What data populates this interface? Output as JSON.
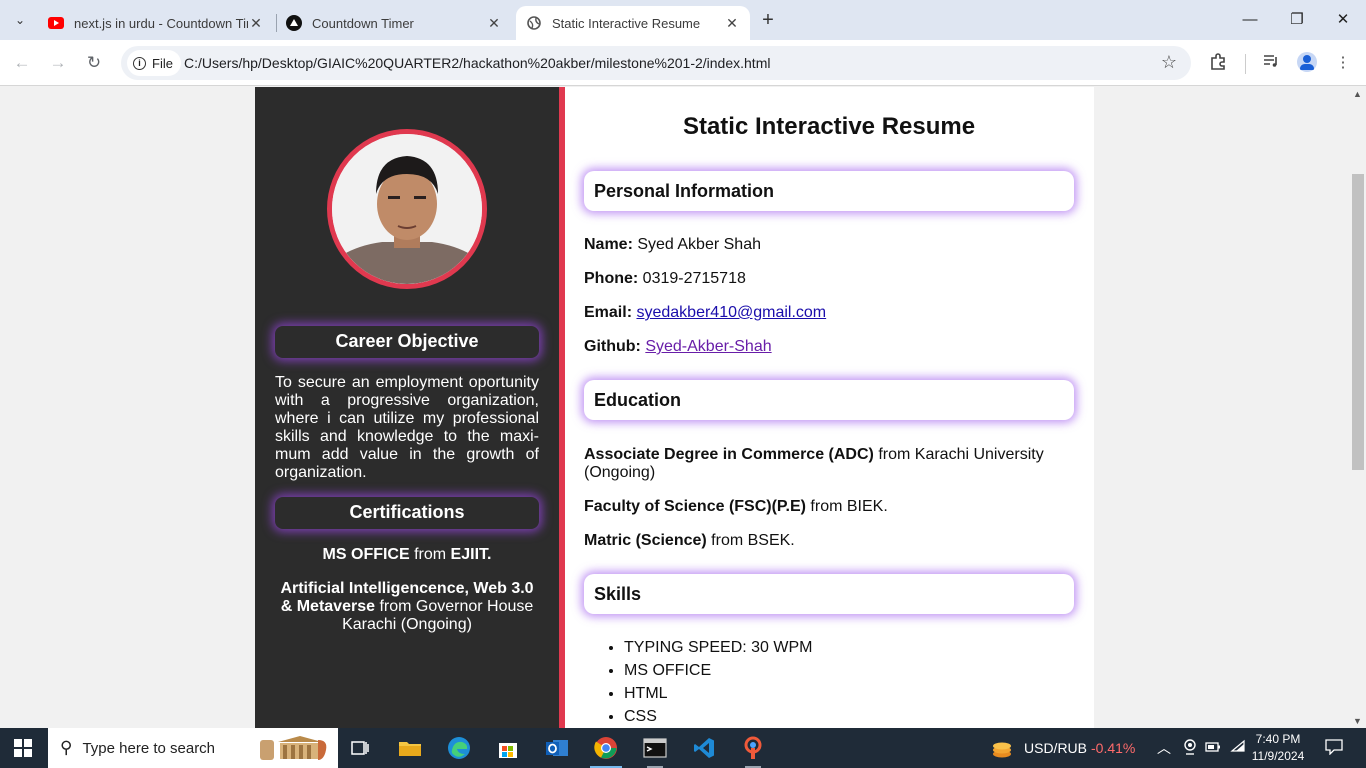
{
  "browser": {
    "tabs": [
      {
        "title": "next.js in urdu - Countdown Tin",
        "favicon": "youtube-icon",
        "active": false
      },
      {
        "title": "Countdown Timer",
        "favicon": "vercel-icon",
        "active": false
      },
      {
        "title": "Static Interactive Resume",
        "favicon": "globe-icon",
        "active": true
      }
    ],
    "address": {
      "scheme_label": "File",
      "url": "C:/Users/hp/Desktop/GIAIC%20QUARTER2/hackathon%20akber/milestone%201-2/index.html"
    }
  },
  "resume": {
    "title": "Static Interactive Resume",
    "left": {
      "career_heading": "Career Objective",
      "career_text": "To secure an employment oportunity with a progressive organization, where i can utilize my professional skills and knowledge to the maxi-mum add value in the growth of organization.",
      "cert_heading": "Certifications",
      "certifications": [
        {
          "bold": "MS OFFICE",
          "middle": " from ",
          "bold2": "EJIIT.",
          "rest": ""
        },
        {
          "bold": "Artificial Intelligencence, Web 3.0 & Metaverse",
          "middle": " from Governor House Karachi (Ongoing)",
          "bold2": "",
          "rest": ""
        }
      ]
    },
    "personal": {
      "heading": "Personal Information",
      "name_label": "Name:",
      "name": " Syed Akber Shah",
      "phone_label": "Phone:",
      "phone": " 0319-2715718",
      "email_label": "Email:",
      "email": "syedakber410@gmail.com",
      "github_label": "Github:",
      "github": "Syed-Akber-Shah"
    },
    "education": {
      "heading": "Education",
      "items": [
        {
          "degree": "Associate Degree in Commerce (ADC)",
          "rest": " from Karachi University (Ongoing)"
        },
        {
          "degree": "Faculty of Science (FSC)(P.E)",
          "rest": " from BIEK."
        },
        {
          "degree": "Matric (Science)",
          "rest": " from BSEK."
        }
      ]
    },
    "skills": {
      "heading": "Skills",
      "items": [
        "TYPING SPEED: 30 WPM",
        "MS OFFICE",
        "HTML",
        "CSS"
      ]
    }
  },
  "taskbar": {
    "search_placeholder": "Type here to search",
    "ticker_label": "USD/RUB",
    "ticker_value": "-0.41%",
    "ticker_color": "#ff6b6b",
    "time": "7:40 PM",
    "date": "11/9/2024"
  },
  "colors": {
    "accent_red": "#e0394f",
    "sidebar_bg": "#2c2c2c",
    "glow_purple": "#a46ef0"
  }
}
